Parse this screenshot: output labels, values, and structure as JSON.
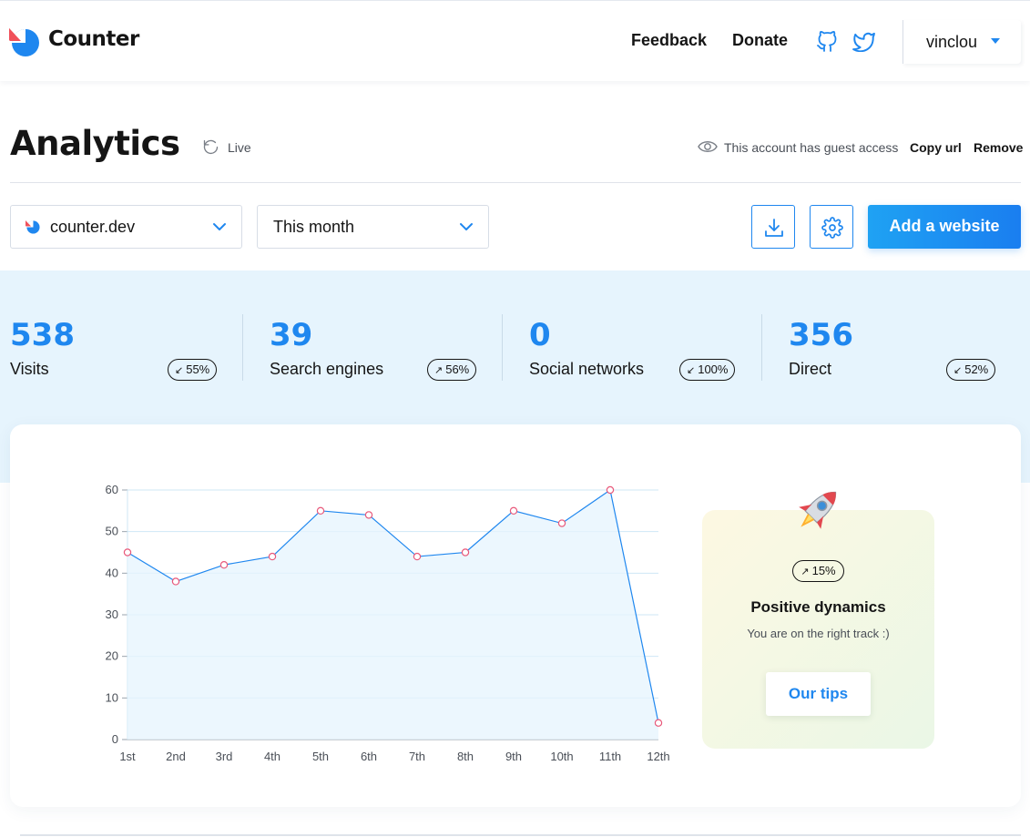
{
  "header": {
    "brand": "Counter",
    "nav": {
      "feedback": "Feedback",
      "donate": "Donate"
    },
    "icons": [
      "github-icon",
      "twitter-icon"
    ],
    "user": "vinclou"
  },
  "page": {
    "title": "Analytics",
    "live_label": "Live",
    "guest_text": "This account has guest access",
    "copy_url": "Copy url",
    "remove": "Remove"
  },
  "controls": {
    "site": "counter.dev",
    "period": "This month",
    "add_website": "Add a website"
  },
  "stats": [
    {
      "value": "538",
      "label": "Visits",
      "badge": "55%",
      "trend": "down"
    },
    {
      "value": "39",
      "label": "Search engines",
      "badge": "56%",
      "trend": "up"
    },
    {
      "value": "0",
      "label": "Social networks",
      "badge": "100%",
      "trend": "down"
    },
    {
      "value": "356",
      "label": "Direct",
      "badge": "52%",
      "trend": "down"
    }
  ],
  "chart_data": {
    "type": "line",
    "categories": [
      "1st",
      "2nd",
      "3rd",
      "4th",
      "5th",
      "6th",
      "7th",
      "8th",
      "9th",
      "10th",
      "11th",
      "12th"
    ],
    "series": [
      {
        "values": [
          45,
          38,
          42,
          44,
          55,
          54,
          44,
          45,
          55,
          52,
          60,
          4
        ]
      }
    ],
    "ylim": [
      0,
      60
    ],
    "yticks": [
      "0",
      "10",
      "20",
      "30",
      "40",
      "50",
      "60"
    ],
    "grid": true,
    "colors": {
      "line": "#1f87ef",
      "marker": "#e8587a",
      "fill": "#e6f4fd"
    }
  },
  "dynamics": {
    "badge": "15%",
    "title": "Positive dynamics",
    "subtitle": "You are on the right track :)",
    "tips": "Our tips"
  },
  "colors": {
    "accent": "#1f87ef",
    "band": "#e6f4fd",
    "text": "#151515",
    "logo_red": "#f0505a"
  }
}
